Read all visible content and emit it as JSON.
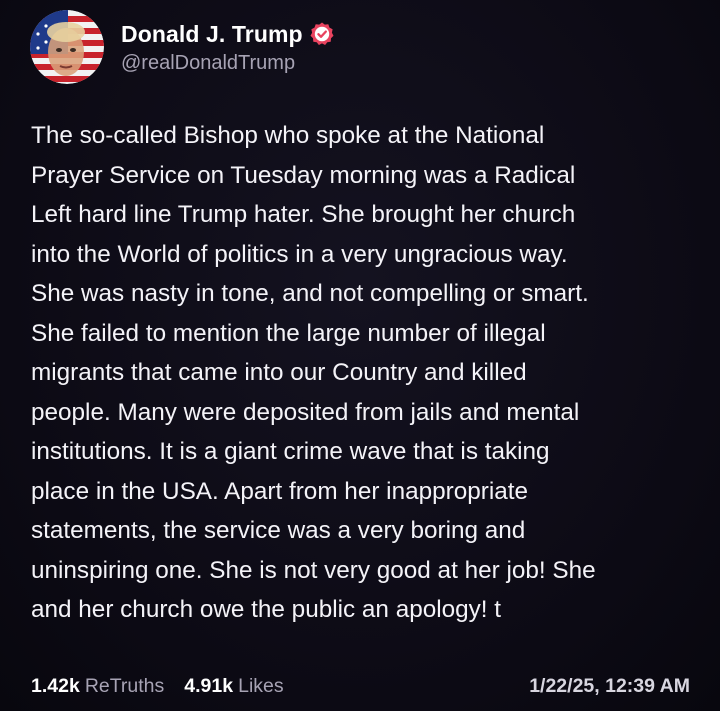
{
  "post": {
    "author": {
      "display_name": "Donald J. Trump",
      "handle": "@realDonaldTrump",
      "verified_icon": "verified-badge-icon",
      "avatar": "profile-avatar"
    },
    "text": "The so-called Bishop who spoke at the National\nPrayer Service on Tuesday morning was a Radical\nLeft hard line Trump hater. She brought her church\ninto the World of politics in a very ungracious way.\nShe was nasty in tone, and not compelling or smart.\nShe failed to mention the large number of illegal\nmigrants that came into our Country and killed\npeople. Many were deposited from jails and mental\ninstitutions. It is a giant crime wave that is taking\nplace in the USA. Apart from her inappropriate\nstatements, the service was a very boring and\nuninspiring one. She is not very good at her job! She\nand her church owe the public an apology! t",
    "stats": {
      "retruths_count": "1.42k",
      "retruths_label": "ReTruths",
      "likes_count": "4.91k",
      "likes_label": "Likes"
    },
    "timestamp": "1/22/25, 12:39 AM"
  },
  "colors": {
    "background": "#0d0b16",
    "text_primary": "#ffffff",
    "text_secondary": "#a7a3b4",
    "verified_badge": "#e8435f"
  }
}
